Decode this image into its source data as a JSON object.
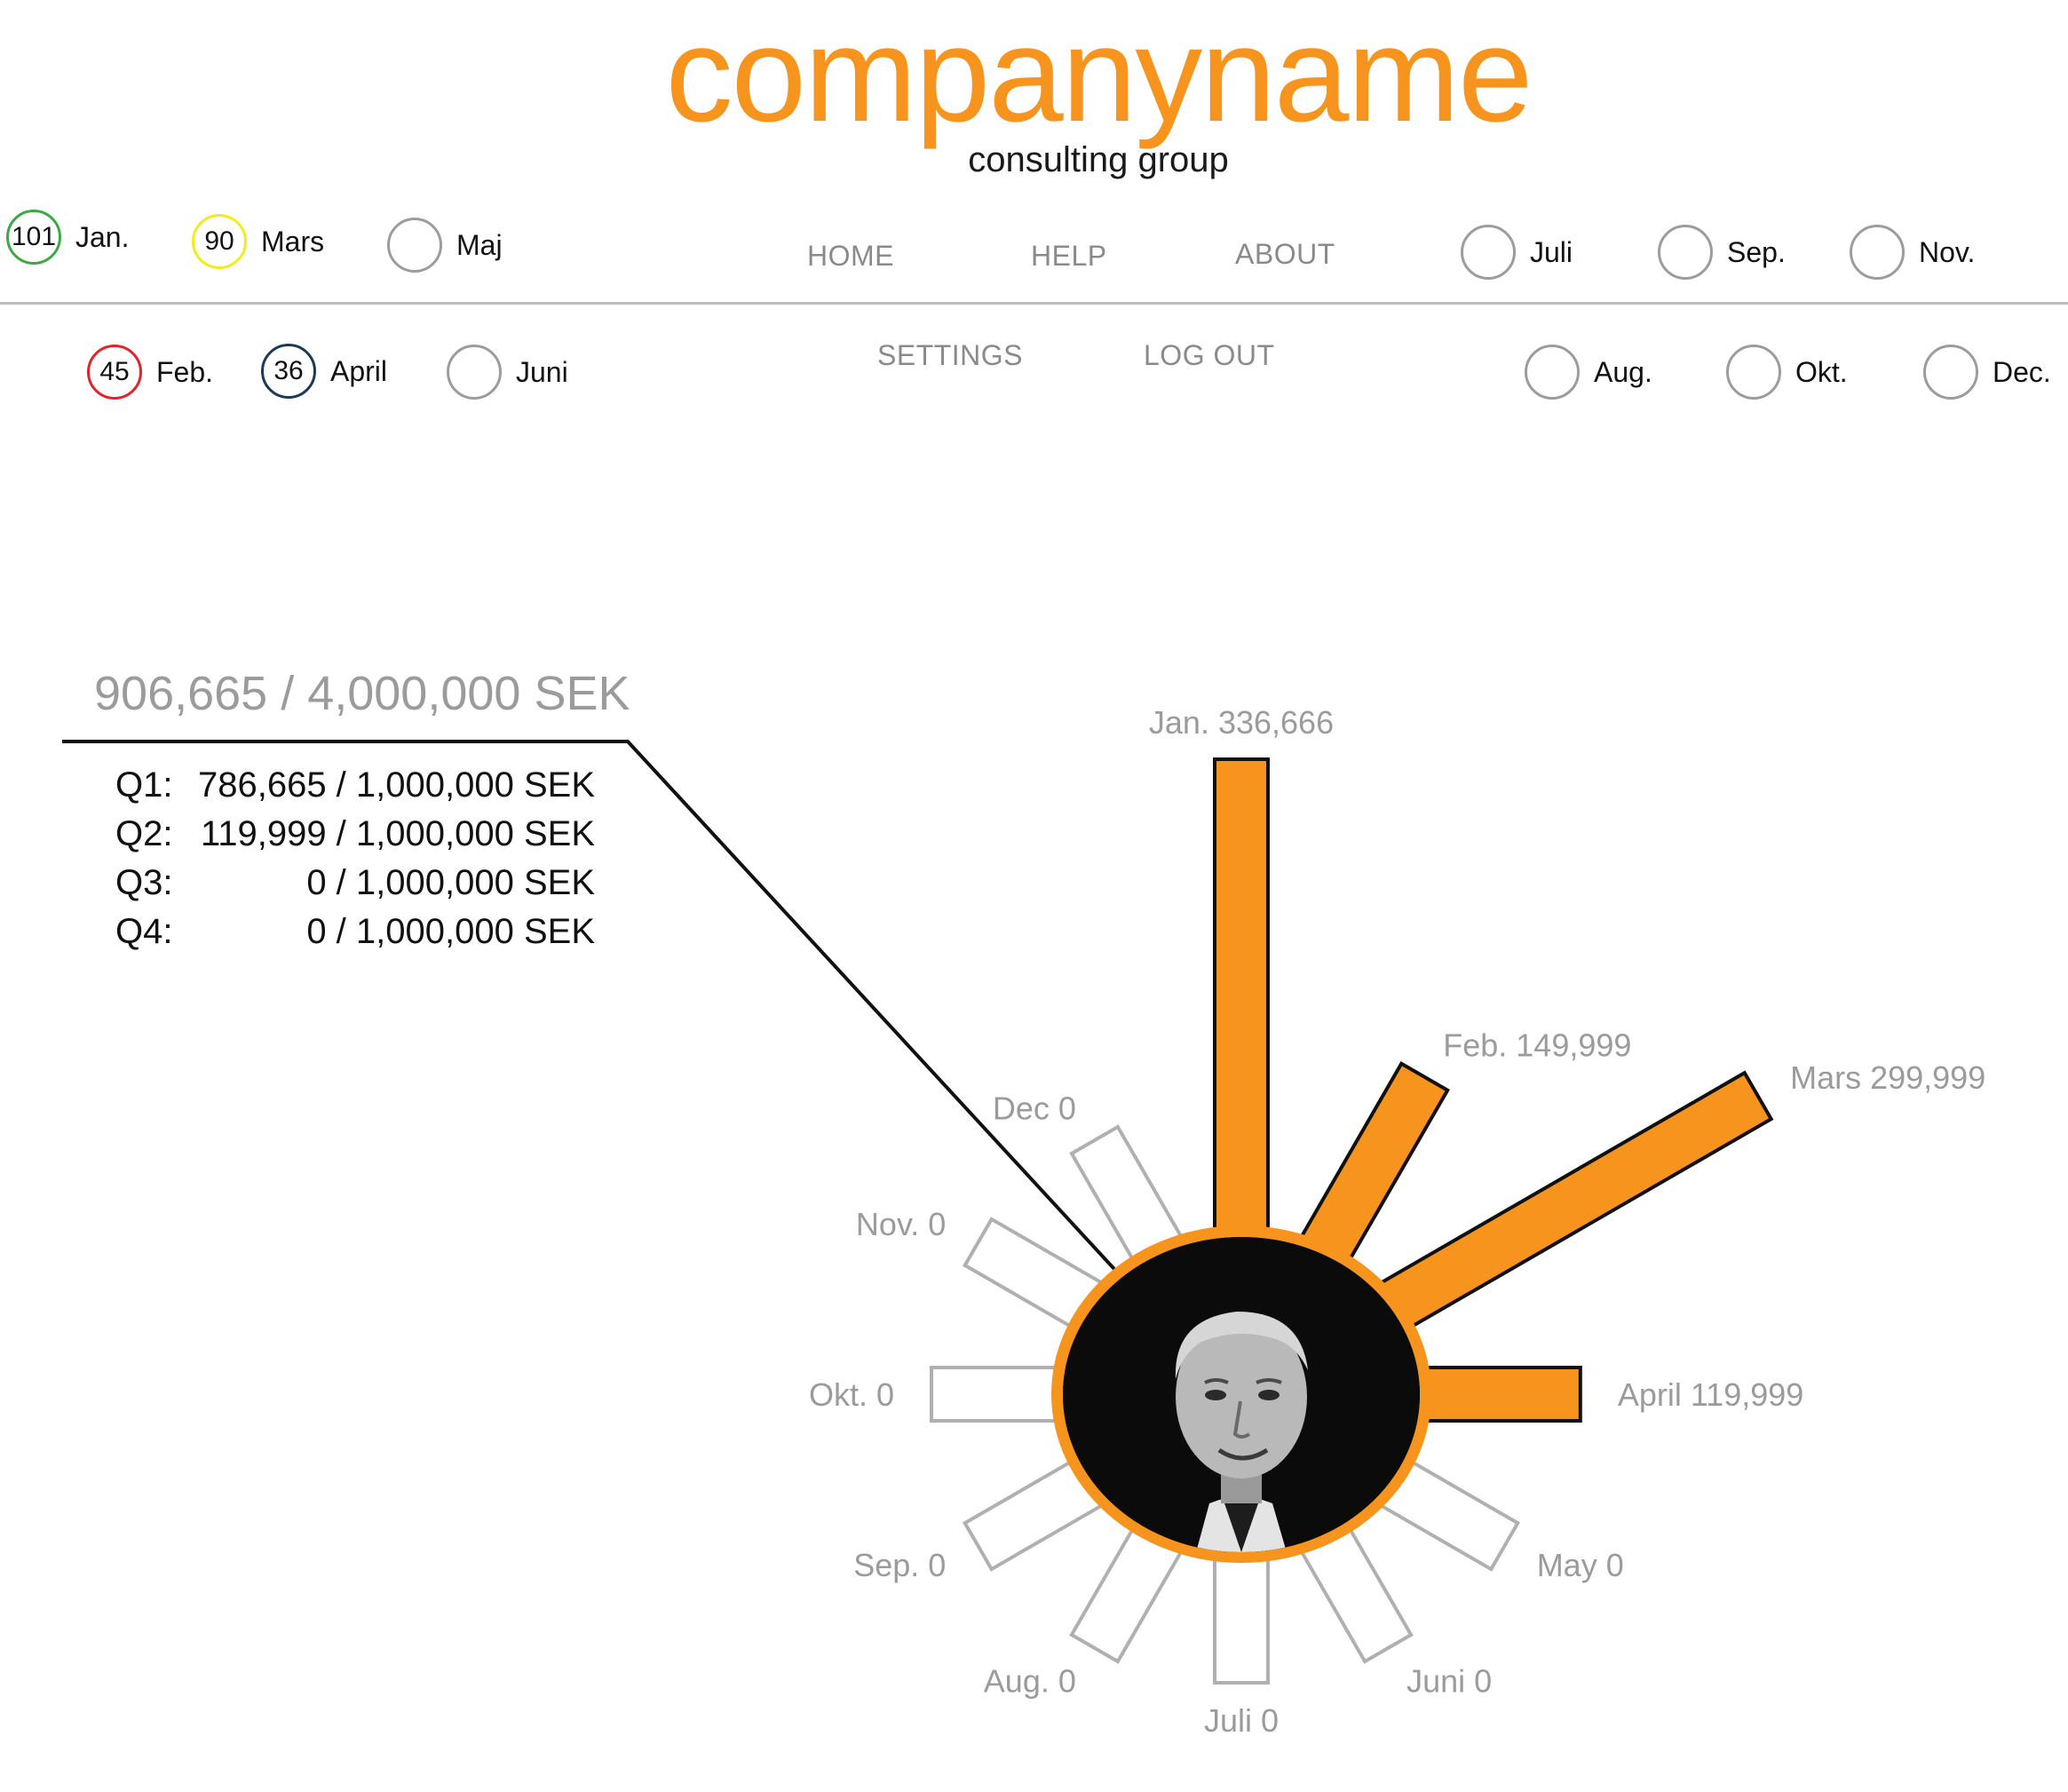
{
  "brand": {
    "name": "companyname",
    "tagline": "consulting group"
  },
  "nav": {
    "home": "HOME",
    "help": "HELP",
    "about": "ABOUT",
    "settings": "SETTINGS",
    "logout": "LOG OUT"
  },
  "months": [
    {
      "label": "Jan.",
      "count": "101",
      "color": "#3aaa45"
    },
    {
      "label": "Feb.",
      "count": "45",
      "color": "#e2232a"
    },
    {
      "label": "Mars",
      "count": "90",
      "color": "#f2ec1c"
    },
    {
      "label": "April",
      "count": "36",
      "color": "#1b3a5a"
    },
    {
      "label": "Maj",
      "count": "",
      "color": "#9c9c9c"
    },
    {
      "label": "Juni",
      "count": "",
      "color": "#9c9c9c"
    },
    {
      "label": "Juli",
      "count": "",
      "color": "#9c9c9c"
    },
    {
      "label": "Aug.",
      "count": "",
      "color": "#9c9c9c"
    },
    {
      "label": "Sep.",
      "count": "",
      "color": "#9c9c9c"
    },
    {
      "label": "Okt.",
      "count": "",
      "color": "#9c9c9c"
    },
    {
      "label": "Nov.",
      "count": "",
      "color": "#9c9c9c"
    },
    {
      "label": "Dec.",
      "count": "",
      "color": "#9c9c9c"
    }
  ],
  "summary": {
    "total": "906,665 / 4,000,000 SEK",
    "quarters": [
      {
        "label": "Q1:",
        "value": "786,665 / 1,000,000 SEK"
      },
      {
        "label": "Q2:",
        "value": "119,999 / 1,000,000 SEK"
      },
      {
        "label": "Q3:",
        "value": "0 / 1,000,000 SEK"
      },
      {
        "label": "Q4:",
        "value": "0 / 1,000,000 SEK"
      }
    ]
  },
  "chart_data": {
    "type": "bar",
    "layout": "radial",
    "categories": [
      "Jan.",
      "Feb.",
      "Mars",
      "April",
      "May",
      "Juni",
      "Juli",
      "Aug.",
      "Sep.",
      "Okt.",
      "Nov.",
      "Dec"
    ],
    "values": [
      336666,
      149999,
      299999,
      119999,
      0,
      0,
      0,
      0,
      0,
      0,
      0,
      0
    ],
    "labels": [
      "Jan. 336,666",
      "Feb. 149,999",
      "Mars 299,999",
      "April 119,999",
      "May 0",
      "Juni 0",
      "Juli 0",
      "Aug. 0",
      "Sep. 0",
      "Okt. 0",
      "Nov. 0",
      "Dec 0"
    ],
    "colors": {
      "filled": "#f7941d",
      "empty": "#b0b0b0",
      "label": "#9b9b9b",
      "ring": "#f7941d"
    }
  }
}
